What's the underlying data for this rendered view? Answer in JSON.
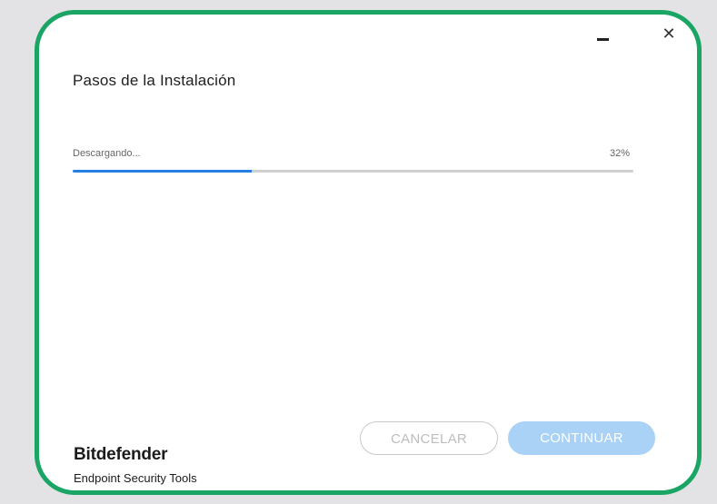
{
  "window": {
    "title": "Pasos de la Instalación",
    "minimize_icon": "minimize-icon",
    "close_icon": "close-icon",
    "close_glyph": "✕"
  },
  "progress": {
    "label": "Descargando...",
    "percent_text": "32%",
    "value": 0.32
  },
  "brand": {
    "name": "Bitdefender",
    "product": "Endpoint Security Tools"
  },
  "buttons": {
    "cancel_label": "CANCELAR",
    "continue_label": "CONTINUAR"
  },
  "colors": {
    "frame_border": "#1aa564",
    "progress_fill": "#2580e6",
    "progress_track": "#cfcfcf",
    "continue_button_bg": "#a9d2f6"
  }
}
